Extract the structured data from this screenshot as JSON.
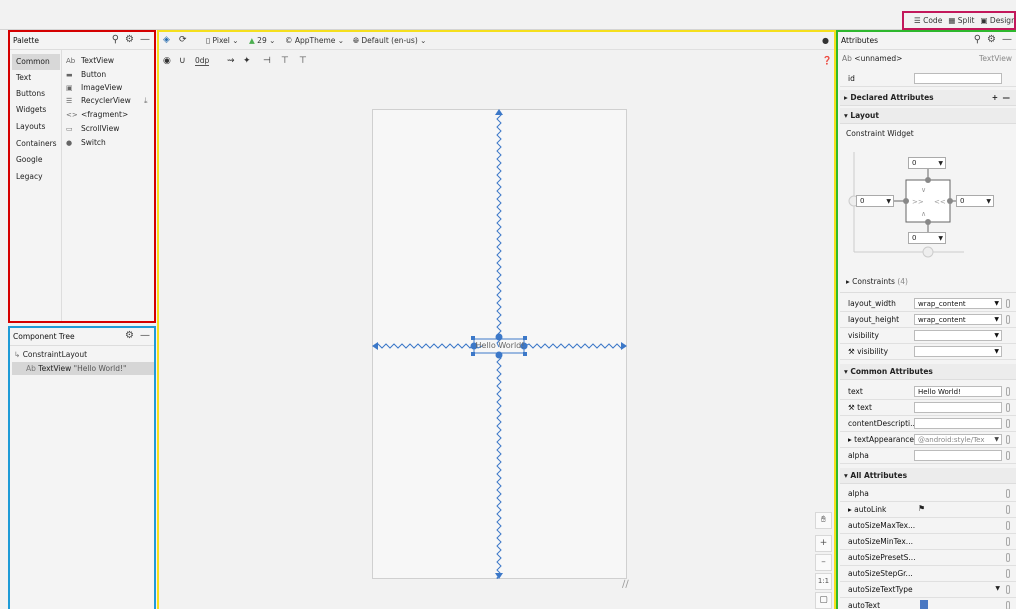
{
  "mode": {
    "code": "Code",
    "split": "Split",
    "design": "Design"
  },
  "palette": {
    "title": "Palette",
    "categories": [
      "Common",
      "Text",
      "Buttons",
      "Widgets",
      "Layouts",
      "Containers",
      "Google",
      "Legacy"
    ],
    "items": [
      "TextView",
      "Button",
      "ImageView",
      "RecyclerView",
      "<fragment>",
      "ScrollView",
      "Switch"
    ]
  },
  "tree": {
    "title": "Component Tree",
    "root": "ConstraintLayout",
    "child": "TextView",
    "child_text": "\"Hello World!\""
  },
  "toolbar": {
    "device": "Pixel",
    "api": "29",
    "theme": "AppTheme",
    "locale": "Default (en-us)",
    "margin": "0dp"
  },
  "canvas": {
    "text": "Hello World!",
    "zoom_ratio": "1:1"
  },
  "attributes": {
    "title": "Attributes",
    "type_prefix": "Ab",
    "name": "<unnamed>",
    "type": "TextView",
    "id_label": "id",
    "declared": "Declared Attributes",
    "layout_section": "Layout",
    "constraint_widget": "Constraint Widget",
    "margins": {
      "top": "0",
      "left": "0",
      "right": "0",
      "bottom": "0"
    },
    "constraints": "Constraints",
    "constraints_count": "(4)",
    "rows": [
      {
        "label": "layout_width",
        "value": "wrap_content"
      },
      {
        "label": "layout_height",
        "value": "wrap_content"
      },
      {
        "label": "visibility",
        "value": ""
      },
      {
        "label": "visibility",
        "value": ""
      }
    ],
    "common": "Common Attributes",
    "common_rows": [
      {
        "label": "text",
        "value": "Hello World!"
      },
      {
        "label": "text",
        "value": ""
      },
      {
        "label": "contentDescripti...",
        "value": ""
      },
      {
        "label": "textAppearance",
        "value": "@android:style/Tex"
      },
      {
        "label": "alpha",
        "value": ""
      }
    ],
    "all": "All Attributes",
    "all_rows": [
      "alpha",
      "autoLink",
      "autoSizeMaxTex...",
      "autoSizeMinTex...",
      "autoSizePresetS...",
      "autoSizeStepGr...",
      "autoSizeTextType",
      "autoText"
    ]
  }
}
